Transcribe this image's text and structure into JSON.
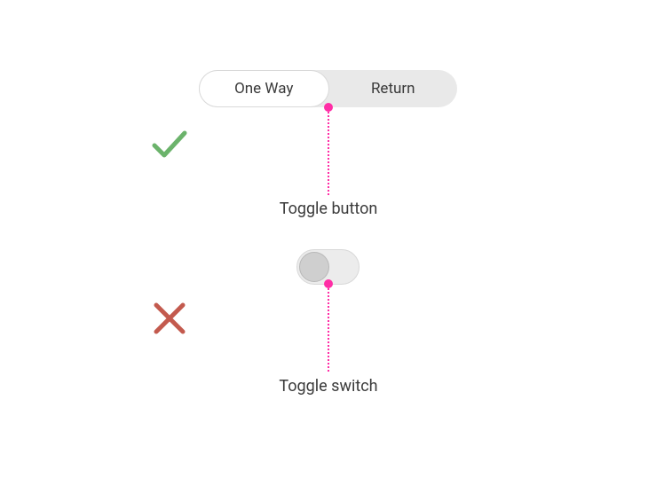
{
  "segmented": {
    "option_a": "One Way",
    "option_b": "Return"
  },
  "captions": {
    "toggle_button": "Toggle button",
    "toggle_switch": "Toggle switch"
  },
  "colors": {
    "accent_leader": "#ff2ea6",
    "good": "#6bb36b",
    "bad": "#c35a4e",
    "panel_bg": "#e9e9e9"
  },
  "icons": {
    "check": "check-icon",
    "cross": "cross-icon"
  }
}
